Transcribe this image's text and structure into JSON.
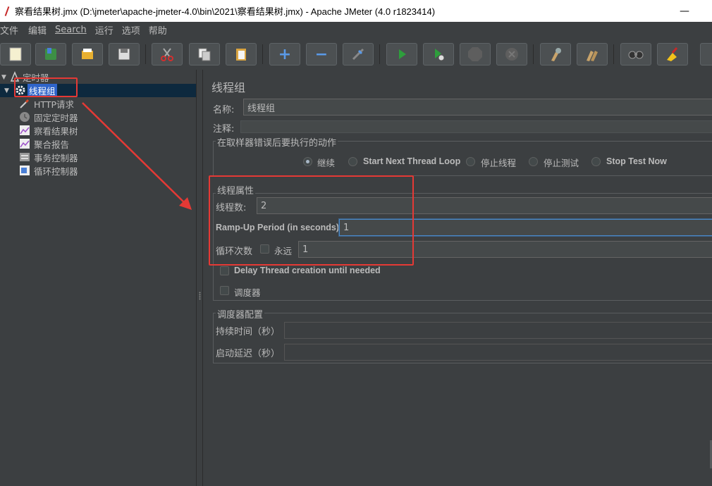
{
  "window": {
    "title": "察看结果树.jmx (D:\\jmeter\\apache-jmeter-4.0\\bin\\2021\\察看结果树.jmx) - Apache JMeter (4.0 r1823414)",
    "minimize_glyph": "—",
    "maximize_glyph": "□"
  },
  "menu": {
    "items": [
      "文件",
      "编辑",
      "Search",
      "运行",
      "选项",
      "帮助"
    ]
  },
  "toolbar": {
    "buttons": [
      {
        "name": "new-icon"
      },
      {
        "name": "templates-icon"
      },
      {
        "name": "open-icon"
      },
      {
        "name": "save-icon"
      },
      {
        "name": "cut-icon"
      },
      {
        "name": "copy-icon"
      },
      {
        "name": "paste-icon"
      },
      {
        "name": "expand-icon",
        "glyph": "+"
      },
      {
        "name": "collapse-icon",
        "glyph": "−"
      },
      {
        "name": "toggle-icon"
      },
      {
        "name": "start-icon"
      },
      {
        "name": "start-no-pauses-icon"
      },
      {
        "name": "stop-icon",
        "glyph": "STOP"
      },
      {
        "name": "shutdown-icon"
      },
      {
        "name": "clear-icon"
      },
      {
        "name": "clear-all-icon"
      },
      {
        "name": "search-icon"
      },
      {
        "name": "reset-search-icon"
      }
    ]
  },
  "tree": {
    "root": {
      "label": "定时器",
      "icon": "testplan-icon"
    },
    "selected": {
      "label": "线程组",
      "icon": "gear-icon"
    },
    "children": [
      {
        "label": "HTTP请求",
        "icon": "pipette-icon"
      },
      {
        "label": "固定定时器",
        "icon": "timer-icon"
      },
      {
        "label": "察看结果树",
        "icon": "graph-icon"
      },
      {
        "label": "聚合报告",
        "icon": "graph-icon"
      },
      {
        "label": "事务控制器",
        "icon": "controller-icon"
      },
      {
        "label": "循环控制器",
        "icon": "loop-icon"
      }
    ]
  },
  "panel": {
    "title": "线程组",
    "name_label": "名称:",
    "name_value": "线程组",
    "comment_label": "注释:",
    "comment_value": "",
    "error_action": {
      "title": "在取样器错误后要执行的动作",
      "options": [
        "继续",
        "Start Next Thread Loop",
        "停止线程",
        "停止测试",
        "Stop Test Now"
      ],
      "selected": "继续"
    },
    "thread_props": {
      "title": "线程属性",
      "threads_label": "线程数:",
      "threads_value": "2",
      "rampup_label": "Ramp-Up Period (in seconds):",
      "rampup_value": "1",
      "loop_label": "循环次数",
      "forever_label": "永远",
      "loop_value": "1",
      "delay_label": "Delay Thread creation until needed",
      "scheduler_label": "调度器"
    },
    "scheduler": {
      "title": "调度器配置",
      "duration_label": "持续时间（秒）",
      "delay_label": "启动延迟（秒）"
    }
  },
  "colors": {
    "background": "#3c3f41",
    "selection": "#2f65ca",
    "annotation": "#e53935"
  }
}
